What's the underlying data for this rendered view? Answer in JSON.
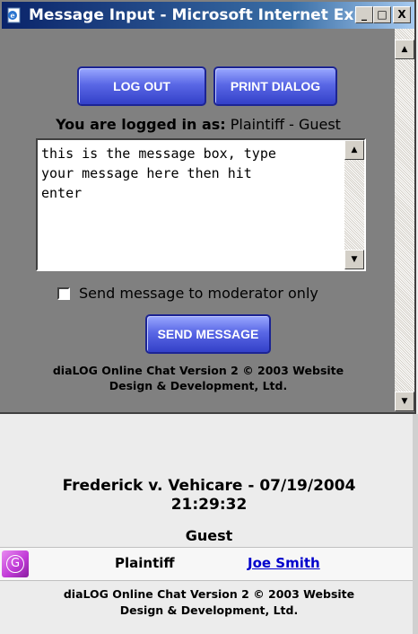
{
  "window": {
    "title": "Message Input - Microsoft Internet Exp...",
    "minimize": "_",
    "maximize": "□",
    "close": "X"
  },
  "toolbar": {
    "logout_label": "LOG OUT",
    "print_label": "PRINT DIALOG"
  },
  "session": {
    "logged_prefix": "You are logged in as:",
    "logged_user": "Plaintiff - Guest"
  },
  "message": {
    "text": "this is the message box, type\nyour message here then hit\nenter"
  },
  "options": {
    "moderator_only_label": "Send message to moderator only",
    "moderator_only_checked": false
  },
  "send": {
    "label": "SEND MESSAGE"
  },
  "footer": {
    "line1": "diaLOG Online Chat Version 2 © 2003 Website",
    "line2": "Design & Development, Ltd."
  },
  "chat": {
    "case_line1": "Frederick v. Vehicare - 07/19/2004",
    "case_line2": "21:29:32",
    "group_label": "Guest",
    "participants": [
      {
        "avatar_letter": "G",
        "role": "Plaintiff",
        "name": "Joe Smith"
      }
    ]
  },
  "icons": {
    "title": "ie-page-icon",
    "avatar": "guest-avatar-icon"
  },
  "colors": {
    "title_bar": "#0a246a",
    "button_blue": "#4a58dc",
    "link": "#0000cc",
    "avatar": "#c23cd8"
  }
}
